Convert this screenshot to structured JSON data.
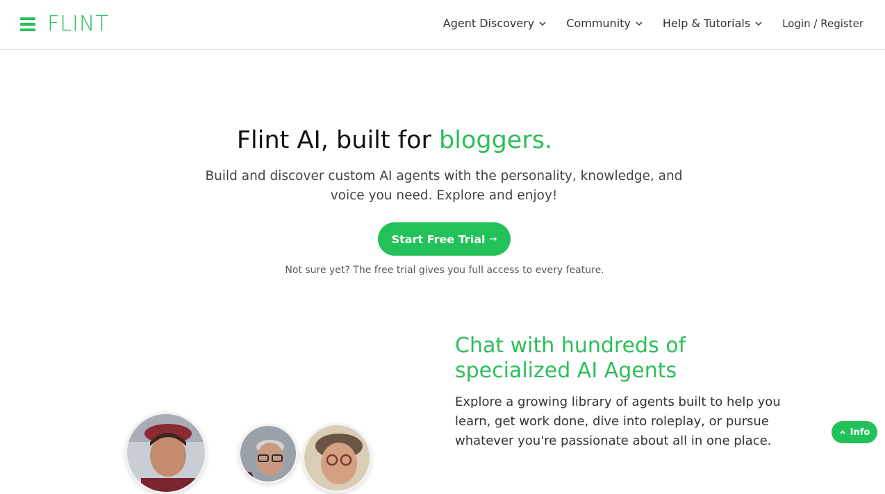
{
  "brand": {
    "name": "FLINT",
    "accent_color": "#2cbe5a"
  },
  "nav": {
    "items": [
      {
        "label": "Agent Discovery",
        "icon": "chevron-down-icon"
      },
      {
        "label": "Community",
        "icon": "chevron-down-icon"
      },
      {
        "label": "Help & Tutorials",
        "icon": "chevron-down-icon"
      }
    ],
    "login": "Login / Register"
  },
  "hero": {
    "title_prefix": "Flint AI, built for ",
    "title_accent": "bloggers.",
    "subtitle": "Build and discover custom AI agents with the personality, knowledge, and voice you need. Explore and enjoy!",
    "cta_label": "Start Free Trial",
    "cta_arrow": "→",
    "note": "Not sure yet? The free trial gives you full access to every feature."
  },
  "features": {
    "title": "Chat with hundreds of specialized AI Agents",
    "body": "Explore a growing library of agents built to help you learn, get work done, dive into roleplay, or pursue whatever you're passionate about all in one place."
  },
  "info_button": {
    "label": "Info",
    "icon": "chevron-up-icon"
  }
}
